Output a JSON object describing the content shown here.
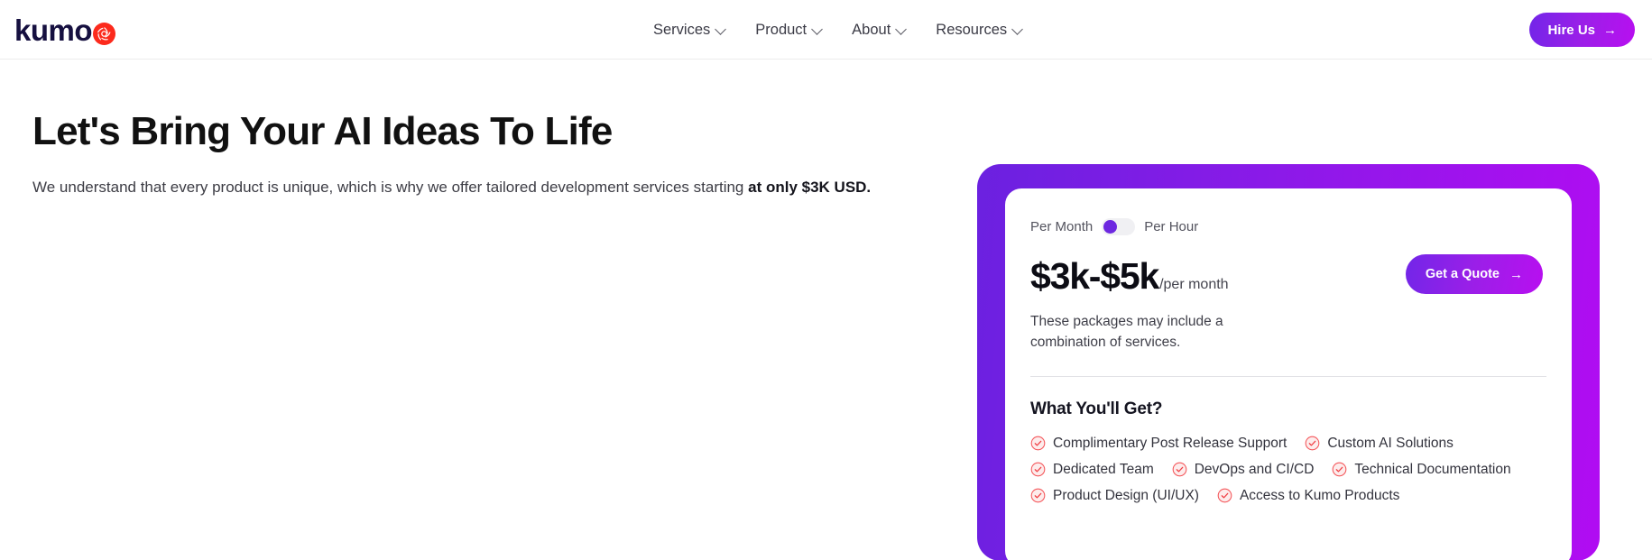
{
  "header": {
    "logo": {
      "text": "kumo",
      "mark_icon": "kumo-circle-mark"
    },
    "nav": [
      {
        "label": "Services",
        "icon": "chevron-down-icon"
      },
      {
        "label": "Product",
        "icon": "chevron-down-icon"
      },
      {
        "label": "About",
        "icon": "chevron-down-icon"
      },
      {
        "label": "Resources",
        "icon": "chevron-down-icon"
      }
    ],
    "cta": {
      "label": "Hire Us",
      "icon": "arrow-right-icon",
      "arrow": "→"
    }
  },
  "hero": {
    "title": "Let's Bring Your AI Ideas To Life",
    "subtitle_lead": "We understand that every product is unique, which is why we offer tailored development services starting ",
    "subtitle_bold": "at only $3K USD."
  },
  "pricing_card": {
    "toggle": {
      "option_left": "Per Month",
      "option_right": "Per Hour",
      "selected": "Per Month"
    },
    "price": "$3k-$5k",
    "price_unit": "/per month",
    "quote_button": {
      "label": "Get a Quote",
      "icon": "arrow-right-icon",
      "arrow": "→"
    },
    "note": "These packages may include a combination of services.",
    "features_title": "What You'll Get?",
    "feature_rows": [
      [
        "Complimentary Post Release Support",
        "Custom AI Solutions"
      ],
      [
        "Dedicated Team",
        "DevOps and CI/CD",
        "Technical Documentation"
      ],
      [
        "Product Design (UI/UX)",
        "Access to Kumo Products"
      ]
    ]
  },
  "colors": {
    "brand_red": "#fc2a1c",
    "gradient_start": "#6b21e0",
    "gradient_end": "#b10cf2",
    "check_icon": "#f4565a",
    "logo_navy": "#161040"
  }
}
